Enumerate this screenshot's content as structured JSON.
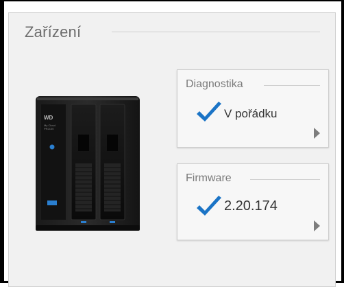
{
  "section": {
    "title": "Zařízení"
  },
  "diagnostics": {
    "label": "Diagnostika",
    "status": "V pořádku",
    "icon": "checkmark-icon"
  },
  "firmware": {
    "label": "Firmware",
    "version": "2.20.174",
    "icon": "checkmark-icon"
  },
  "device": {
    "brand_line1": "My Cloud",
    "brand_line2": "PR2100",
    "logo": "WD"
  },
  "colors": {
    "accent": "#1b74c6",
    "panel_bg": "#f1f1f1",
    "text": "#6d6d6d"
  }
}
